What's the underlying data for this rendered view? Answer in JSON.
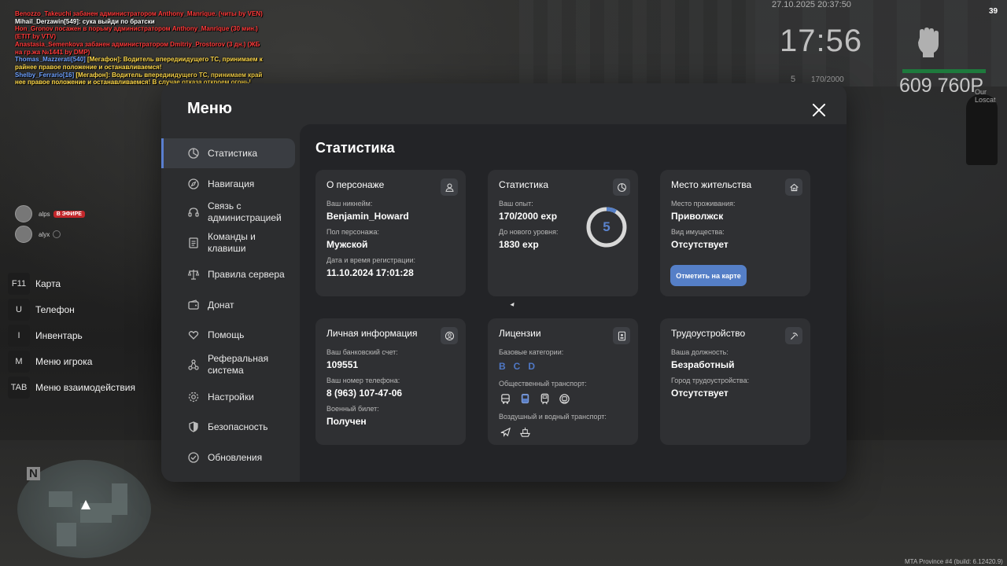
{
  "chat": [
    {
      "parts": [
        {
          "t": "Benozzo_Takeuchi забанен администратором Anthony_Manrique. (читы by VEN)",
          "c": "red"
        }
      ]
    },
    {
      "parts": [
        {
          "t": "Mihail_Derzawin[549]: сука выйди по братски",
          "c": "white"
        }
      ]
    },
    {
      "parts": [
        {
          "t": "Hon_Gronov посажен в порьму администратором Anthony_Manrique (30 мин.)",
          "c": "red"
        }
      ]
    },
    {
      "parts": [
        {
          "t": "(ETIT by VTV)",
          "c": "red"
        }
      ]
    },
    {
      "parts": [
        {
          "t": "Anastasia_Semenkova забанен администратором Dmitriy_Prostorov (3 дн.) (ЖБ",
          "c": "red"
        }
      ]
    },
    {
      "parts": [
        {
          "t": "на гр.жа №1441 by DMP)",
          "c": "red"
        }
      ]
    },
    {
      "parts": [
        {
          "t": "Thomas_Mazzerati[540] ",
          "c": "blue"
        },
        {
          "t": "[Мегафон]: Водитель впередиидущего ТС, принимаем к",
          "c": "yellow"
        }
      ]
    },
    {
      "parts": [
        {
          "t": "райнее правое положение и останавливаемся!",
          "c": "yellow"
        }
      ]
    },
    {
      "parts": [
        {
          "t": "Shelby_Ferrario[16] ",
          "c": "blue"
        },
        {
          "t": "[Мегафон]: Водитель впередиидущего ТС, принимаем край",
          "c": "yellow"
        }
      ]
    },
    {
      "parts": [
        {
          "t": "нее правое положение и останавливаемся! В случае отказа откроем огонь!",
          "c": "yellow"
        }
      ]
    }
  ],
  "hud": {
    "date": "27.10.2025 20:37:50",
    "ping": "39",
    "time": "17:56",
    "level": "5",
    "exp": "170/2000",
    "money": "609 760Р",
    "tag": "Our Loscat"
  },
  "voice": [
    {
      "name": "alps",
      "badge": "В ЭФИРЕ"
    },
    {
      "name": "alyx",
      "badge": ""
    }
  ],
  "keys": [
    {
      "key": "F11",
      "label": "Карта"
    },
    {
      "key": "U",
      "label": "Телефон"
    },
    {
      "key": "I",
      "label": "Инвентарь"
    },
    {
      "key": "M",
      "label": "Меню игрока"
    },
    {
      "key": "TAB",
      "label": "Меню взаимодействия"
    }
  ],
  "minimap": {
    "north": "N"
  },
  "footer": "MTA Province #4 (build: 6.12420.9)",
  "menu": {
    "title": "Меню",
    "sidebar": [
      {
        "label": "Статистика",
        "icon": "pie-chart-icon",
        "active": true
      },
      {
        "label": "Навигация",
        "icon": "compass-icon",
        "active": false
      },
      {
        "label": "Связь с администрацией",
        "icon": "headset-icon",
        "active": false
      },
      {
        "label": "Команды и клавиши",
        "icon": "document-icon",
        "active": false
      },
      {
        "label": "Правила сервера",
        "icon": "scales-icon",
        "active": false
      },
      {
        "label": "Донат",
        "icon": "wallet-icon",
        "active": false
      },
      {
        "label": "Помощь",
        "icon": "heart-hand-icon",
        "active": false
      },
      {
        "label": "Реферальная система",
        "icon": "network-icon",
        "active": false
      },
      {
        "label": "Настройки",
        "icon": "gear-icon",
        "active": false
      },
      {
        "label": "Безопасность",
        "icon": "shield-icon",
        "active": false
      },
      {
        "label": "Обновления",
        "icon": "check-circle-icon",
        "active": false
      }
    ],
    "content_title": "Статистика",
    "cards": {
      "character": {
        "title": "О персонаже",
        "nick_label": "Ваш никнейм:",
        "nick": "Benjamin_Howard",
        "gender_label": "Пол персонажа:",
        "gender": "Мужской",
        "reg_label": "Дата и время регистрации:",
        "reg": "11.10.2024 17:01:28"
      },
      "stats": {
        "title": "Статистика",
        "exp_label": "Ваш опыт:",
        "exp": "170/2000 exp",
        "next_label": "До нового уровня:",
        "next": "1830 exp",
        "level": "5",
        "progress": 0.085
      },
      "residence": {
        "title": "Место жительства",
        "place_label": "Место проживания:",
        "place": "Приволжск",
        "property_label": "Вид имущества:",
        "property": "Отсутствует",
        "button": "Отметить на карте"
      },
      "personal": {
        "title": "Личная информация",
        "bank_label": "Ваш банковский счет:",
        "bank": "109551",
        "phone_label": "Ваш номер телефона:",
        "phone": "8 (963) 107-47-06",
        "military_label": "Военный билет:",
        "military": "Получен"
      },
      "licenses": {
        "title": "Лицензии",
        "base_label": "Базовые категории:",
        "base": [
          "B",
          "C",
          "D"
        ],
        "public_label": "Общественный транспорт:",
        "public_icons": [
          "bus-icon",
          "tram-icon",
          "train-icon",
          "metro-icon"
        ],
        "air_label": "Воздушный и водный транспорт:",
        "air_icons": [
          "plane-icon",
          "boat-icon"
        ]
      },
      "job": {
        "title": "Трудоустройство",
        "position_label": "Ваша должность:",
        "position": "Безработный",
        "city_label": "Город трудоустройства:",
        "city": "Отсутствует"
      }
    }
  },
  "colors": {
    "accent": "#557fc7",
    "panel": "#2c2d2f",
    "card": "#2f3033",
    "content": "#232427"
  }
}
